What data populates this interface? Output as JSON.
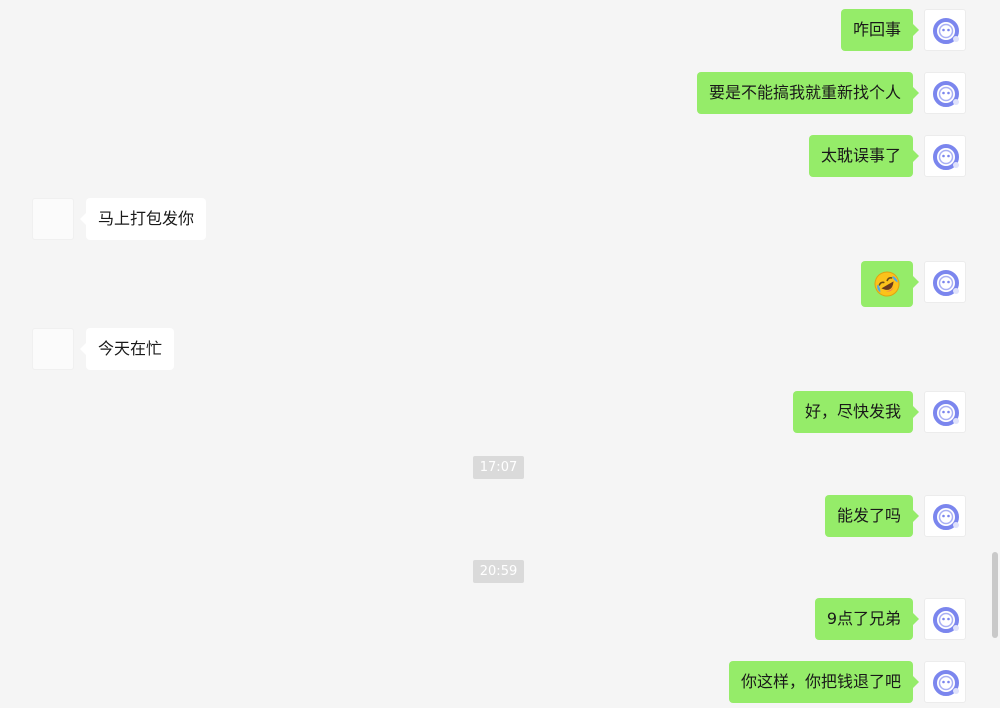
{
  "messages": [
    {
      "sender": "me",
      "text": "咋回事"
    },
    {
      "sender": "me",
      "text": "要是不能搞我就重新找个人"
    },
    {
      "sender": "me",
      "text": "太耽误事了"
    },
    {
      "sender": "other",
      "text": "马上打包发你"
    },
    {
      "sender": "me",
      "type": "emoji",
      "emoji": "rolling-laughing-emoji"
    },
    {
      "sender": "other",
      "text": "今天在忙"
    },
    {
      "sender": "me",
      "text": "好，尽快发我"
    },
    {
      "timestamp": "17:07"
    },
    {
      "sender": "me",
      "text": "能发了吗"
    },
    {
      "timestamp": "20:59"
    },
    {
      "sender": "me",
      "text": "9点了兄弟"
    },
    {
      "sender": "me",
      "text": "你这样，你把钱退了吧"
    }
  ],
  "colors": {
    "background": "#f5f5f5",
    "my_bubble": "#95ec69",
    "other_bubble": "#ffffff",
    "timestamp_bg": "#dadada",
    "avatar_accent": "#7b86ee"
  }
}
